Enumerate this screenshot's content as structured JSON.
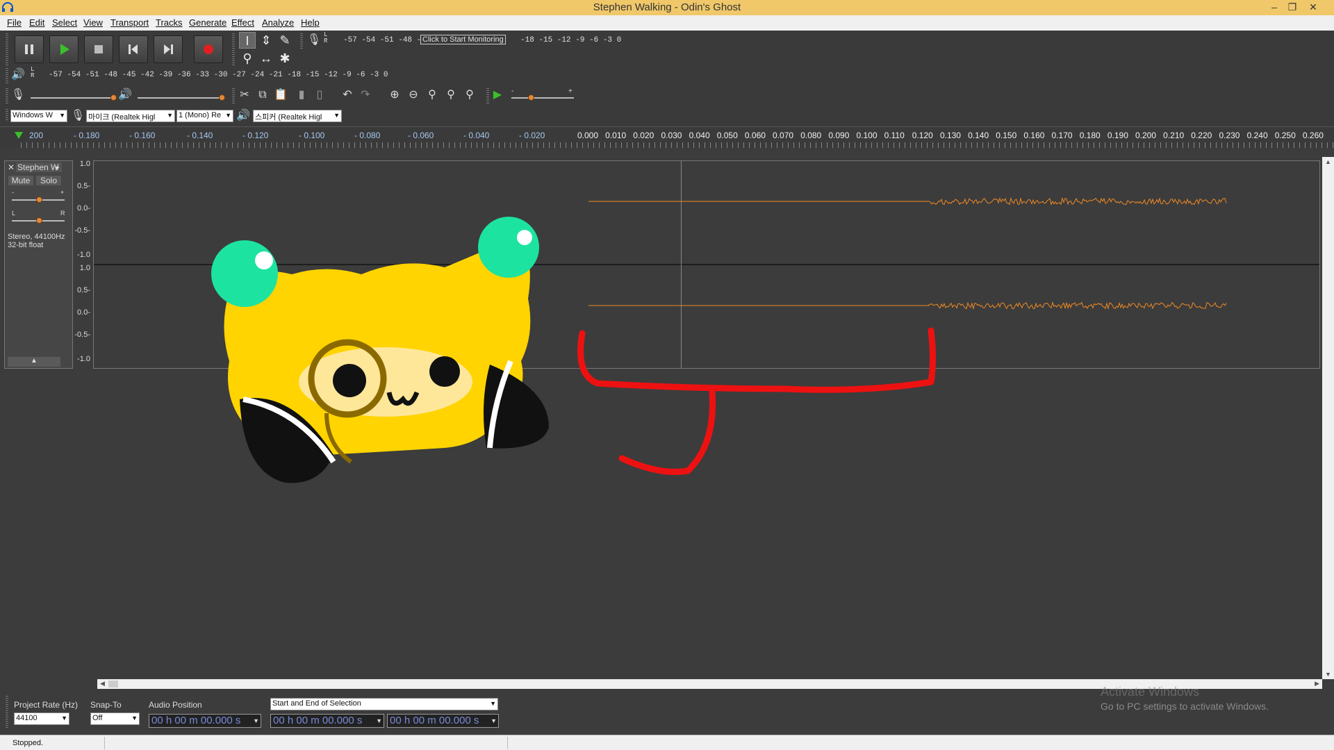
{
  "window": {
    "title": "Stephen Walking - Odin's Ghost",
    "minimize": "–",
    "restore": "❐",
    "close": "✕"
  },
  "menu": [
    "File",
    "Edit",
    "Select",
    "View",
    "Transport",
    "Tracks",
    "Generate",
    "Effect",
    "Analyze",
    "Help"
  ],
  "record_meter": {
    "channels": "L\nR",
    "scale_left": "-57 -54 -51 -48 -45 -42",
    "monitor_label": "Click to Start Monitoring",
    "scale_right": "-18 -15 -12 -9  -6  -3  0"
  },
  "playback_meter": {
    "channels": "L\nR",
    "scale": "-57 -54 -51 -48 -45 -42 -39 -36 -33 -30 -27 -24 -21 -18 -15 -12  -9  -6  -3  0"
  },
  "device": {
    "host": "Windows W",
    "mic": "마이크 (Realtek Higl",
    "channels": "1 (Mono) Re",
    "speaker": "스피커 (Realtek Higl"
  },
  "play_at_speed": {
    "min": "-",
    "max": "+"
  },
  "ruler": {
    "neg_labels": [
      "200",
      "- 0.180",
      "- 0.160",
      "- 0.140",
      "- 0.120",
      "- 0.100",
      "- 0.080",
      "- 0.060",
      "- 0.040",
      "- 0.020"
    ],
    "pos_labels": [
      "0.000",
      "0.010",
      "0.020",
      "0.030",
      "0.040",
      "0.050",
      "0.060",
      "0.070",
      "0.080",
      "0.090",
      "0.100",
      "0.110",
      "0.120",
      "0.130",
      "0.140",
      "0.150",
      "0.160",
      "0.170",
      "0.180",
      "0.190",
      "0.200",
      "0.210",
      "0.220",
      "0.230",
      "0.240",
      "0.250",
      "0.260"
    ]
  },
  "track": {
    "close": "✕",
    "name": "Stephen W",
    "mute": "Mute",
    "solo": "Solo",
    "gain_min": "-",
    "gain_max": "+",
    "pan_left": "L",
    "pan_right": "R",
    "info_line1": "Stereo, 44100Hz",
    "info_line2": "32-bit float",
    "collapse": "▲",
    "vruler_labels": [
      "1.0",
      "0.5-",
      "0.0-",
      "-0.5-",
      "-1.0",
      "1.0",
      "0.5-",
      "0.0-",
      "-0.5-",
      "-1.0"
    ]
  },
  "selection_toolbar": {
    "project_rate_label": "Project Rate (Hz)",
    "project_rate_value": "44100",
    "snap_label": "Snap-To",
    "snap_value": "Off",
    "audio_position_label": "Audio Position",
    "audio_position_value": "00 h 00 m 00.000 s",
    "selection_mode": "Start and End of Selection",
    "selection_start": "00 h 00 m 00.000 s",
    "selection_end": "00 h 00 m 00.000 s"
  },
  "status": "Stopped.",
  "activate": {
    "line1": "Activate Windows",
    "line2": "Go to PC settings to activate Windows."
  },
  "colors": {
    "waveform": "#f08a24",
    "mascot_body": "#ffd400",
    "mascot_eyes_orbs": "#1de3a0",
    "drawing_red": "#ee1111"
  }
}
